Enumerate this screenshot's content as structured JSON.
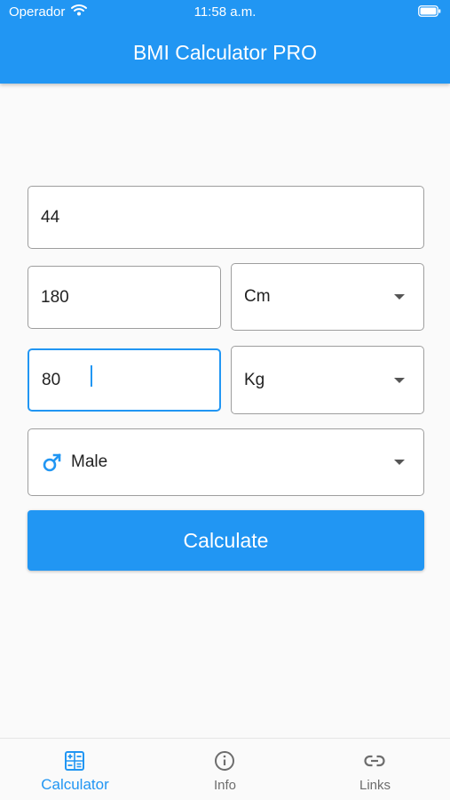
{
  "status_bar": {
    "carrier": "Operador",
    "time": "11:58 a.m."
  },
  "app_bar": {
    "title": "BMI Calculator PRO"
  },
  "form": {
    "age_value": "44",
    "height_value": "180",
    "height_unit": "Cm",
    "weight_value": "80",
    "weight_unit": "Kg",
    "gender": "Male"
  },
  "calculate_label": "Calculate",
  "bottom_nav": {
    "items": [
      {
        "label": "Calculator",
        "icon": "calculator-icon",
        "active": true
      },
      {
        "label": "Info",
        "icon": "info-icon",
        "active": false
      },
      {
        "label": "Links",
        "icon": "link-icon",
        "active": false
      }
    ]
  },
  "colors": {
    "primary": "#2196f3",
    "background": "#fafafa",
    "inactive": "#6d6d6d"
  }
}
